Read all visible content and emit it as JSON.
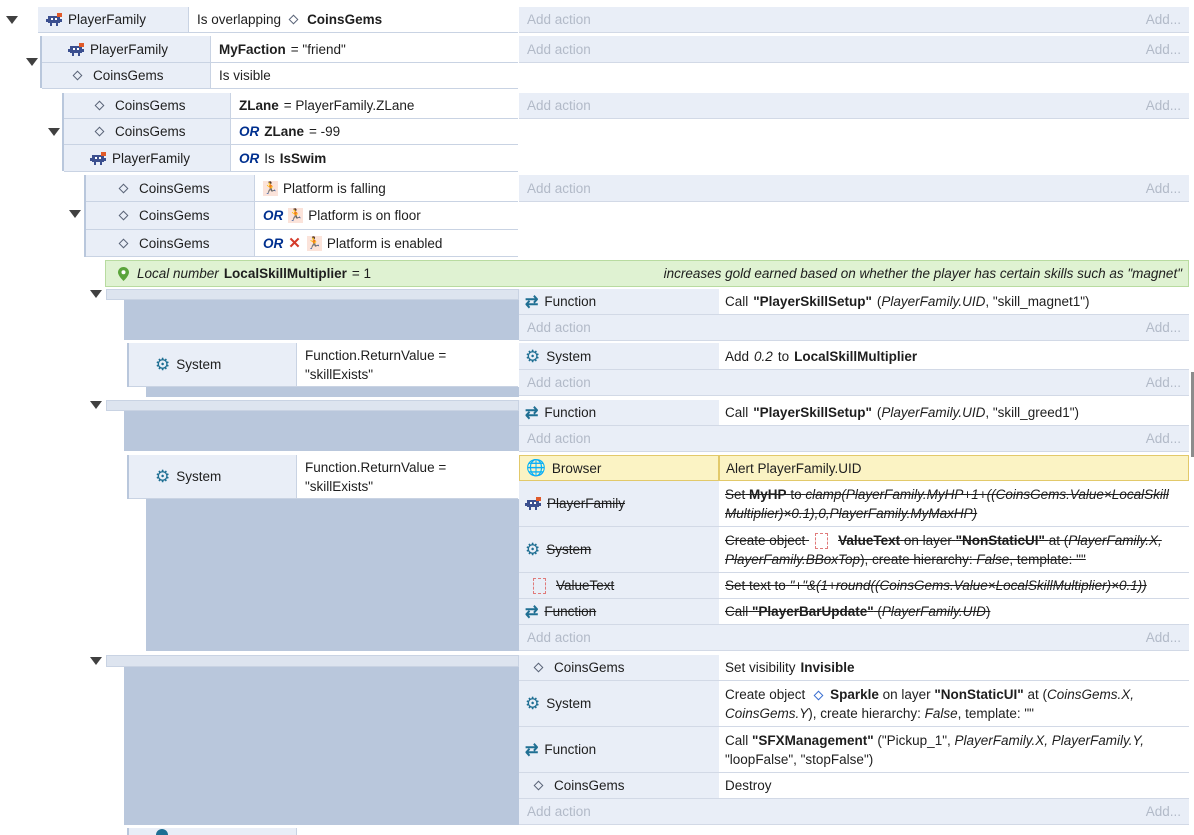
{
  "colors": {
    "sidebar": "#b9c7dc",
    "header_bg": "#e9eef7",
    "comment_bg": "#dff2d2",
    "highlight": "#fbf3c4",
    "or_keyword": "#00308f",
    "add_action": "#b2bac8"
  },
  "add_action_label": "Add action",
  "add_short": "Add...",
  "or_kw": "OR",
  "ev1": {
    "obj": "PlayerFamily",
    "cond": "Is overlapping",
    "target": "CoinsGems"
  },
  "ev2": {
    "c1_obj": "PlayerFamily",
    "c1_var": "MyFaction",
    "c1_rest": "= \"friend\"",
    "c2_obj": "CoinsGems",
    "c2_text": "Is visible"
  },
  "ev3": {
    "c1_obj": "CoinsGems",
    "c1_var": "ZLane",
    "c1_rest": "= PlayerFamily.ZLane",
    "c2_obj": "CoinsGems",
    "c2_var": "ZLane",
    "c2_rest": "= -99",
    "c3_obj": "PlayerFamily",
    "c3_is": "Is",
    "c3_var": "IsSwim"
  },
  "ev4": {
    "c1_obj": "CoinsGems",
    "c1_text": "Platform is falling",
    "c2_obj": "CoinsGems",
    "c2_text": "Platform is on floor",
    "c3_obj": "CoinsGems",
    "c3_text": "Platform is enabled"
  },
  "local_var": {
    "prefix": "Local number",
    "name": "LocalSkillMultiplier",
    "rest": "= 1",
    "comment": "increases gold earned based on whether the player has certain skills such as \"magnet\""
  },
  "ev5": {
    "act_obj": "Function",
    "call": "Call",
    "fn": "\"PlayerSkillSetup\"",
    "args_open": "(",
    "args_italic": "PlayerFamily.UID",
    "args_rest": ", \"skill_magnet1\")"
  },
  "ev6": {
    "cond_obj": "System",
    "cond_text": "Function.ReturnValue = \"skillExists\"",
    "act_obj": "System",
    "add": "Add",
    "amount": "0.2",
    "to": "to",
    "var": "LocalSkillMultiplier"
  },
  "ev7": {
    "act_obj": "Function",
    "call": "Call",
    "fn": "\"PlayerSkillSetup\"",
    "args_open": "(",
    "args_italic": "PlayerFamily.UID",
    "args_rest": ", \"skill_greed1\")"
  },
  "ev8": {
    "cond_obj": "System",
    "cond_text": "Function.ReturnValue = \"skillExists\"",
    "a1_obj": "Browser",
    "a1_text": "Alert PlayerFamily.UID",
    "a2_obj": "PlayerFamily",
    "a2_set": "Set",
    "a2_var": "MyHP",
    "a2_to": "to",
    "a2_expr": "clamp(PlayerFamily.MyHP+1+((CoinsGems.Value×LocalSkillMultiplier)×0.1),0,PlayerFamily.MyMaxHP)",
    "a3_obj": "System",
    "a3_create": "Create object",
    "a3_target": "ValueText",
    "a3_on": "on layer",
    "a3_layer": "\"NonStaticUI\"",
    "a3_at": "at (",
    "a3_x": "PlayerFamily.X,",
    "a3_y": "PlayerFamily.BBoxTop",
    "a3_hier": "), create hierarchy:",
    "a3_false": "False",
    "a3_tmpl": ", template: \"\"",
    "a4_obj": "ValueText",
    "a4_text": "Set text to",
    "a4_expr": "\"+\"&(1+round((CoinsGems.Value×LocalSkillMultiplier)×0.1))",
    "a5_obj": "Function",
    "a5_call": "Call",
    "a5_fn": "\"PlayerBarUpdate\"",
    "a5_args_italic": "PlayerFamily.UID"
  },
  "ev9": {
    "a1_obj": "CoinsGems",
    "a1_text": "Set visibility",
    "a1_val": "Invisible",
    "a2_obj": "System",
    "a2_create": "Create object",
    "a2_target": "Sparkle",
    "a2_on": "on layer",
    "a2_layer": "\"NonStaticUI\"",
    "a2_at": "at (",
    "a2_x": "CoinsGems.X,",
    "a2_y": "CoinsGems.Y",
    "a2_hier": "), create hierarchy:",
    "a2_false": "False",
    "a2_tmpl": ", template: \"\"",
    "a3_obj": "Function",
    "a3_call": "Call",
    "a3_fn": "\"SFXManagement\"",
    "a3_args": "(\"Pickup_1\",",
    "a3_args_italic": "PlayerFamily.X, PlayerFamily.Y,",
    "a3_args2": "\"loopFalse\", \"stopFalse\")",
    "a4_obj": "CoinsGems",
    "a4_text": "Destroy"
  }
}
